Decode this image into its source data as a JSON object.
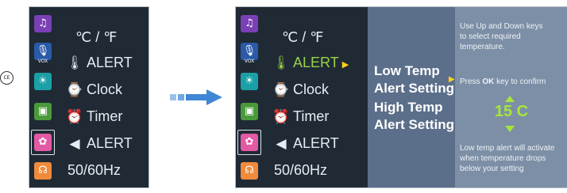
{
  "badge": {
    "text": "CE"
  },
  "left_screen": {
    "menu": [
      {
        "label": "℃ / ℉",
        "icon": "none"
      },
      {
        "label": "ALERT",
        "icon": "thermometer-icon"
      },
      {
        "label": "Clock",
        "icon": "clock-icon"
      },
      {
        "label": "Timer",
        "icon": "alarm-clock-icon"
      },
      {
        "label": "ALERT",
        "icon": "speaker-icon"
      },
      {
        "label": "50/60Hz",
        "icon": "none"
      }
    ],
    "icons": [
      "music-icon",
      "vox-icon",
      "brightness-icon",
      "display-icon",
      "settings-icon",
      "headphones-icon"
    ],
    "vox_label": "VOX"
  },
  "right_screen": {
    "menu": [
      {
        "label": "℃ / ℉"
      },
      {
        "label": "ALERT"
      },
      {
        "label": "Clock"
      },
      {
        "label": "Timer"
      },
      {
        "label": "ALERT"
      },
      {
        "label": "50/60Hz"
      }
    ],
    "vox_label": "VOX",
    "submenu": {
      "line1": "Low Temp",
      "line2": "Alert Setting",
      "line3": "High Temp",
      "line4": "Alert Setting"
    },
    "info": {
      "line1": "Use Up and Down keys",
      "line2": "to select required",
      "line3": "temperature.",
      "press_pre": "Press ",
      "press_key": "OK",
      "press_post": " key to confirm",
      "temp_value": "15 C",
      "alert1": "Low temp alert will activate",
      "alert2": "when temperature drops",
      "alert3": "below your setting"
    }
  },
  "colors": {
    "screen_bg": "#1f2a35",
    "highlight_green": "#9bd14a",
    "arrow_yellow": "#ffd21a",
    "submenu_bg": "#5b6f8a",
    "info_bg": "#7d8fa6",
    "transition_arrow": "#3f86d6"
  }
}
